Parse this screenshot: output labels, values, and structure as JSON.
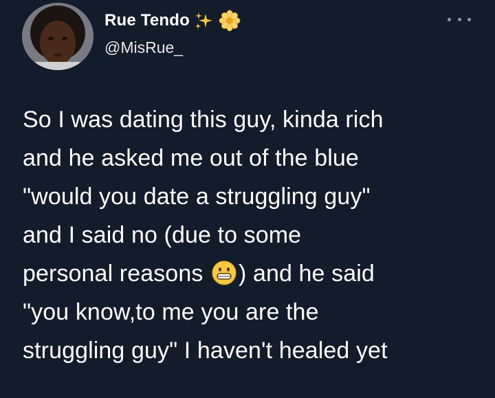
{
  "tweet": {
    "author": {
      "display_name": "Rue Tendo",
      "handle": "@MisRue_",
      "name_emojis": [
        "sparkles-icon",
        "blossom-icon"
      ]
    },
    "more_icon": "more-options-icon",
    "body_lines": [
      "So I was dating this guy, kinda rich",
      "and he asked me out of the blue",
      "\"would you date a struggling guy\"",
      "and I said no (due to some",
      "personal reasons",
      ") and he said",
      "\"you know,to me you are the",
      "struggling guy\" I haven't healed yet"
    ],
    "inline_emoji": "grinning-face-icon"
  },
  "colors": {
    "background": "#131c2b",
    "text": "#ffffff",
    "secondary": "#8b98a5"
  }
}
